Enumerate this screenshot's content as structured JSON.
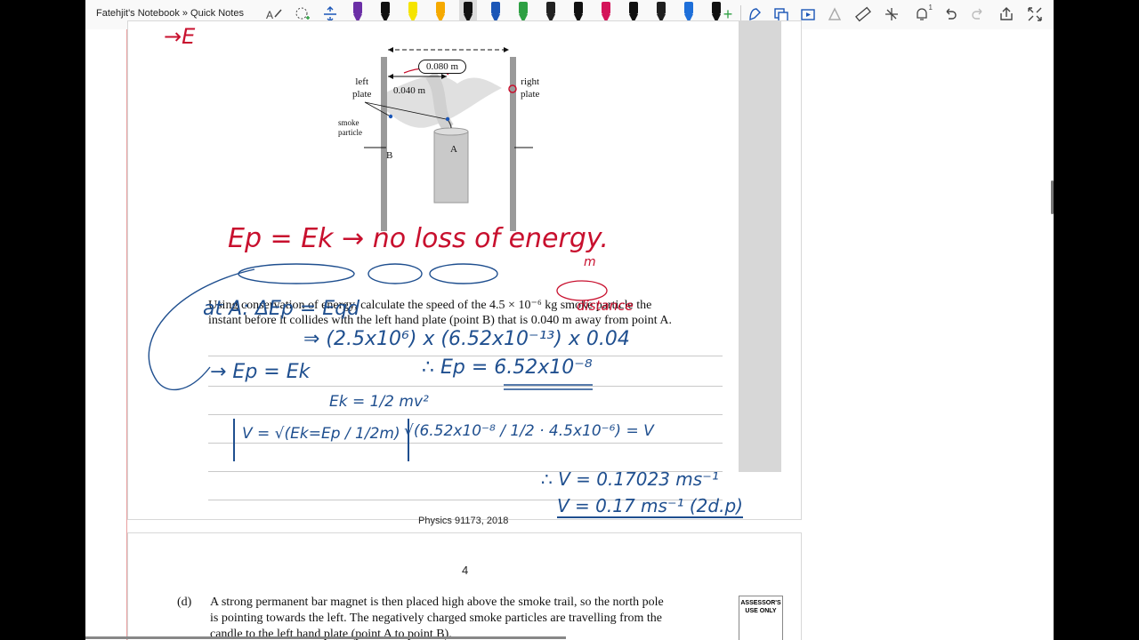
{
  "app": {
    "breadcrumb": "Fatehjit's Notebook » Quick Notes"
  },
  "toolbar": {
    "icons": [
      "handwriting-to-text-icon",
      "lasso-select-icon",
      "insert-space-icon",
      "ink-to-shape-icon",
      "ink-to-math-icon",
      "ink-replay-icon",
      "ruler-icon",
      "eraser-icon",
      "pan-icon",
      "notification-icon",
      "undo-icon",
      "redo-icon",
      "share-icon",
      "expand-icon"
    ],
    "notification_count": "1",
    "pen_colors": [
      "#6b2fa6",
      "#111111",
      "#f5e400",
      "#f5a900",
      "#111111",
      "#1b56b7",
      "#2ea043",
      "#222222",
      "#111111",
      "#d4145a",
      "#111111",
      "#1f1f1f",
      "#1e6fd9",
      "#111111"
    ],
    "add_label": "+"
  },
  "page1": {
    "diagram": {
      "distance_total": "0.080 m",
      "distance_half": "0.040 m",
      "left_plate": [
        "left",
        "plate"
      ],
      "right_plate": [
        "right",
        "plate"
      ],
      "smoke_particle": [
        "smoke",
        "particle"
      ],
      "point_a": "A",
      "point_b": "B"
    },
    "question_line1": "Using conservation of energy, calculate the speed of the 4.5 × 10⁻⁶ kg smoke particle the",
    "question_line2": "instant before it collides with the left hand plate (point B) that is 0.040 m away from point A.",
    "footer": "Physics 91173, 2018"
  },
  "annotations": {
    "top_fragment": "→E",
    "energy_line": "Ep = Ek → no loss of energy.",
    "m_note": "m",
    "distance_note": "distance",
    "at_line": "at A: ΔEp = Eqd",
    "calc_line": "⇒ (2.5x10⁶) x (6.52x10⁻¹³) x 0.04",
    "ep_line": "→ Ep = Ek",
    "ep_value": "∴ Ep = 6.52x10⁻⁸",
    "ek_formula": "Ek = 1/2 mv²",
    "v_formula_left": "V = √(Ek=Ep / 1/2m)",
    "v_formula_right": "√(6.52x10⁻⁸ / 1/2 · 4.5x10⁻⁶) = V",
    "v_result": "∴ V = 0.17023 ms⁻¹",
    "v_final": "V = 0.17 ms⁻¹ (2d.p)"
  },
  "page2": {
    "page_number": "4",
    "part_label": "(d)",
    "text_line1": "A strong permanent bar magnet is then placed high above the smoke trail, so the north pole",
    "text_line2": "is pointing towards the left. The negatively charged smoke particles are travelling from the",
    "text_line3": "candle to the left hand plate (point A to point B).",
    "assessor": [
      "ASSESSOR'S",
      "USE ONLY"
    ]
  }
}
